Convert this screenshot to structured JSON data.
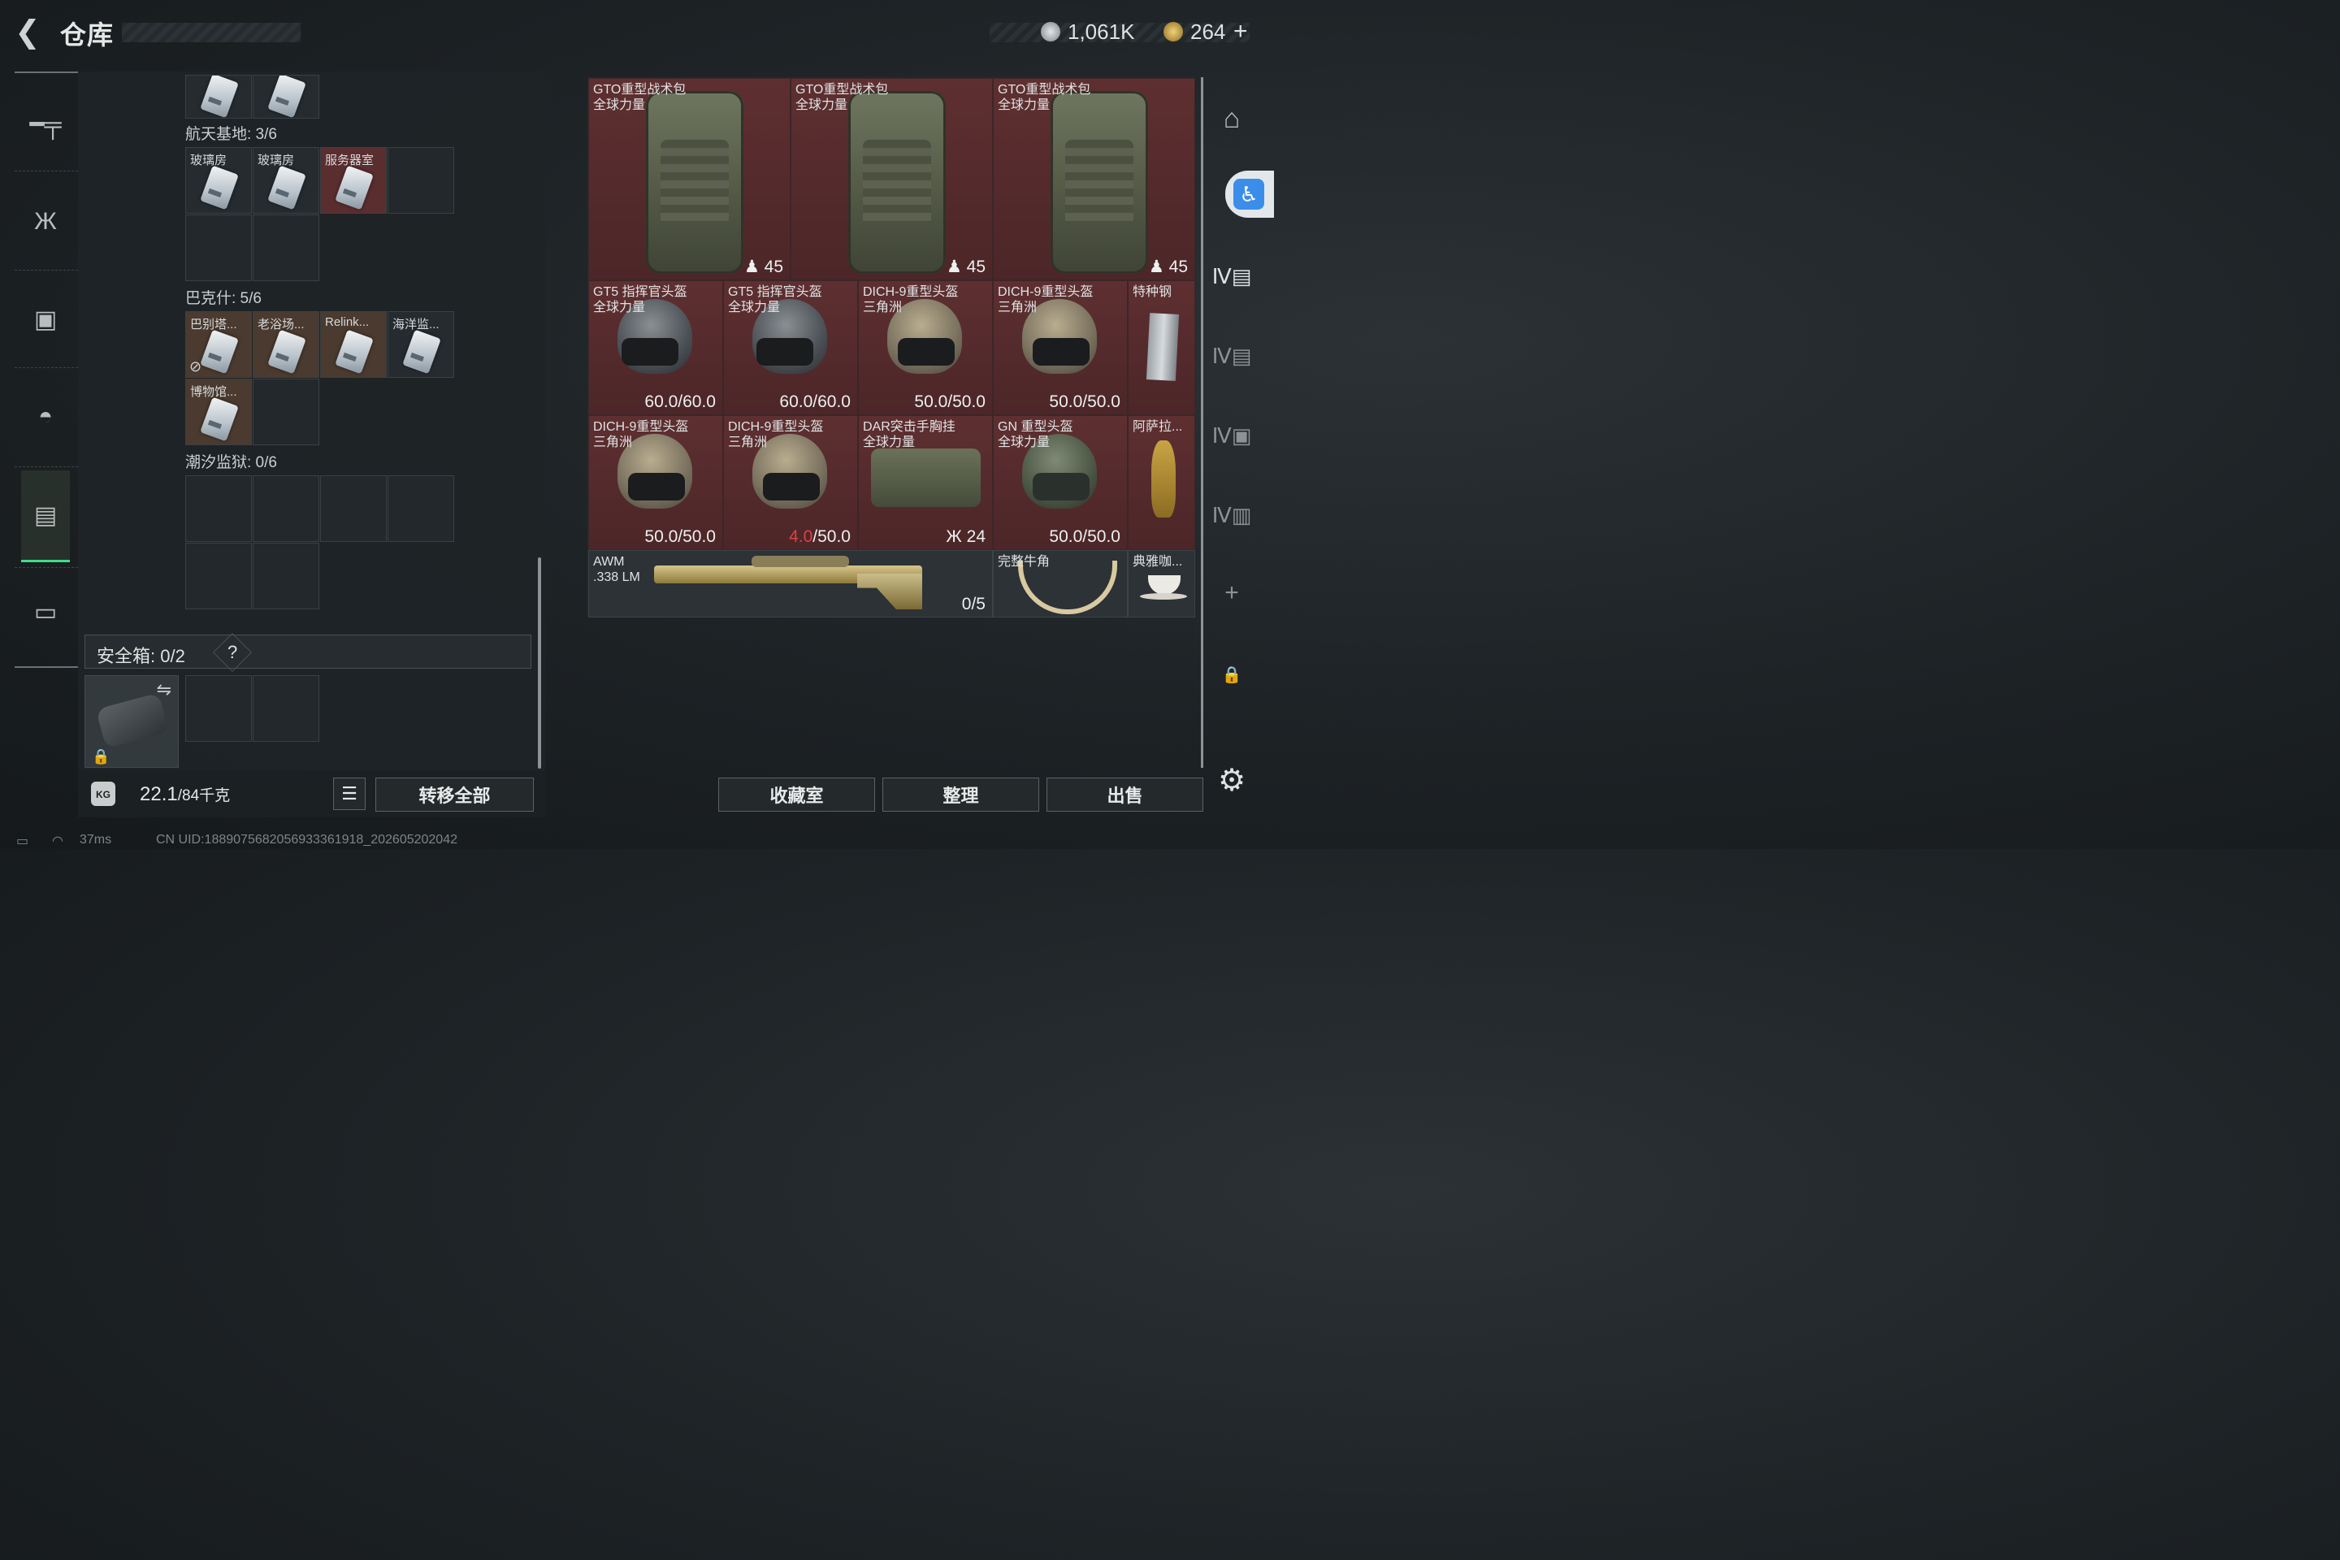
{
  "header": {
    "title": "仓库",
    "currency": [
      {
        "icon": "silver-coin-icon",
        "value": "1,061K",
        "color": "#b8bcbf"
      },
      {
        "icon": "gold-triangle-coin-icon",
        "value": "264",
        "add": "+",
        "color": "#c9a23a"
      }
    ]
  },
  "nav": {
    "items": [
      {
        "name": "weapon",
        "icon": "gun-icon",
        "glyph": "▬"
      },
      {
        "name": "armor",
        "icon": "vest-icon",
        "glyph": "Ж"
      },
      {
        "name": "backpack",
        "icon": "backpack-icon",
        "glyph": "▣"
      },
      {
        "name": "helmet",
        "icon": "helmet-icon",
        "glyph": "◓"
      },
      {
        "name": "storage",
        "icon": "container-icon",
        "glyph": "▤",
        "active": true
      },
      {
        "name": "case",
        "icon": "briefcase-icon",
        "glyph": "▭"
      }
    ],
    "active_color": "#3fdc8a"
  },
  "collection": {
    "sections": [
      {
        "title": "航天基地: 3/6",
        "items": [
          "玻璃房",
          "玻璃房",
          "服务器室"
        ]
      },
      {
        "title": "巴克什: 5/6",
        "items": [
          "巴别塔...",
          "老浴场...",
          "Relink...",
          "海洋监...",
          "博物馆..."
        ]
      },
      {
        "title": "潮汐监狱: 0/6",
        "items": []
      }
    ]
  },
  "safebox": {
    "label": "安全箱:",
    "value": "0/2",
    "help": "?"
  },
  "footer": {
    "weight_current": "22.1",
    "weight_max": "/84千克",
    "transfer_all": "转移全部",
    "collection_room": "收藏室",
    "organize": "整理",
    "sell": "出售"
  },
  "inventory": {
    "backpacks": [
      {
        "name": "GTO重型战术包\n全球力量",
        "value": "45"
      },
      {
        "name": "GTO重型战术包\n全球力量",
        "value": "45"
      },
      {
        "name": "GTO重型战术包\n全球力量",
        "value": "45"
      }
    ],
    "row2": [
      {
        "name": "GT5 指挥官头盔\n全球力量",
        "dur": "60.0",
        "max": "/60.0",
        "kind": "gt5"
      },
      {
        "name": "GT5 指挥官头盔\n全球力量",
        "dur": "60.0",
        "max": "/60.0",
        "kind": "gt5"
      },
      {
        "name": "DICH-9重型头盔\n三角洲",
        "dur": "50.0",
        "max": "/50.0",
        "kind": "dich"
      },
      {
        "name": "DICH-9重型头盔\n三角洲",
        "dur": "50.0",
        "max": "/50.0",
        "kind": "dich"
      },
      {
        "name": "特种钢",
        "dur": "",
        "max": "",
        "kind": "steel"
      }
    ],
    "row3": [
      {
        "name": "DICH-9重型头盔\n三角洲",
        "dur": "50.0",
        "max": "/50.0",
        "kind": "dich"
      },
      {
        "name": "DICH-9重型头盔\n三角洲",
        "dur": "4.0",
        "max": "/50.0",
        "kind": "dich",
        "warn": true
      },
      {
        "name": "DAR突击手胸挂\n全球力量",
        "dur": "24",
        "max": "",
        "kind": "vest"
      },
      {
        "name": "GN 重型头盔\n全球力量",
        "dur": "50.0",
        "max": "/50.0",
        "kind": "gn"
      },
      {
        "name": "阿萨拉...",
        "dur": "",
        "max": "",
        "kind": "pitcher"
      }
    ],
    "row4": [
      {
        "name": "AWM\n.338 LM",
        "value": "0/5",
        "kind": "rifle"
      },
      {
        "name": "完整牛角",
        "value": "",
        "kind": "horns"
      },
      {
        "name": "典雅咖...",
        "value": "",
        "kind": "cup"
      }
    ]
  },
  "status_bar": {
    "ping": "37ms",
    "uid": "CN UID:1889075682056933361918_202605202042"
  }
}
